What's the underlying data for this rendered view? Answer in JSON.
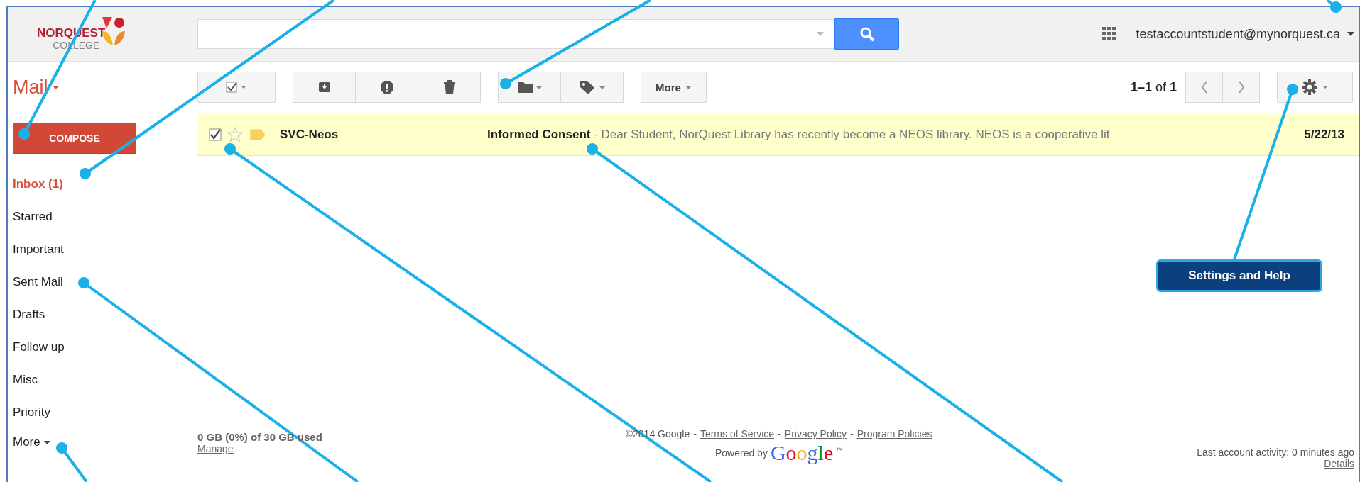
{
  "header": {
    "logo": {
      "name": "NORQUEST",
      "sub": "COLLEGE"
    },
    "account": "testaccountstudent@mynorquest.ca"
  },
  "mail_label": "Mail",
  "compose": "COMPOSE",
  "folders": [
    {
      "label": "Inbox (1)",
      "selected": true
    },
    {
      "label": "Starred",
      "selected": false
    },
    {
      "label": "Important",
      "selected": false
    },
    {
      "label": "Sent Mail",
      "selected": false
    },
    {
      "label": "Drafts",
      "selected": false
    },
    {
      "label": "Follow up",
      "selected": false
    },
    {
      "label": "Misc",
      "selected": false
    },
    {
      "label": "Priority",
      "selected": false
    }
  ],
  "folders_more": "More",
  "toolbar": {
    "more": "More"
  },
  "pagination": {
    "range": "1–1",
    "of": "of",
    "total": "1"
  },
  "messages": [
    {
      "checked": true,
      "starred": false,
      "important": true,
      "sender": "SVC-Neos",
      "subject": "Informed Consent",
      "snippet": " - Dear Student, NorQuest Library has recently become a NEOS library. NEOS is a cooperative lit",
      "date": "5/22/13"
    }
  ],
  "storage": {
    "usage": "0 GB (0%) of 30 GB used",
    "manage": "Manage"
  },
  "footer": {
    "parts": [
      {
        "kind": "text",
        "text": "©2014 Google"
      },
      {
        "kind": "text",
        "text": "-"
      },
      {
        "kind": "link",
        "text": "Terms of Service"
      },
      {
        "kind": "text",
        "text": "-"
      },
      {
        "kind": "link",
        "text": "Privacy Policy"
      },
      {
        "kind": "text",
        "text": "-"
      },
      {
        "kind": "link",
        "text": "Program Policies"
      }
    ],
    "powered": "Powered by",
    "brand": "Google",
    "tm": "™"
  },
  "activity": {
    "text": "Last account activity: 0 minutes ago",
    "details": "Details"
  },
  "annotations": [
    {
      "label": "Settings and Help"
    }
  ]
}
